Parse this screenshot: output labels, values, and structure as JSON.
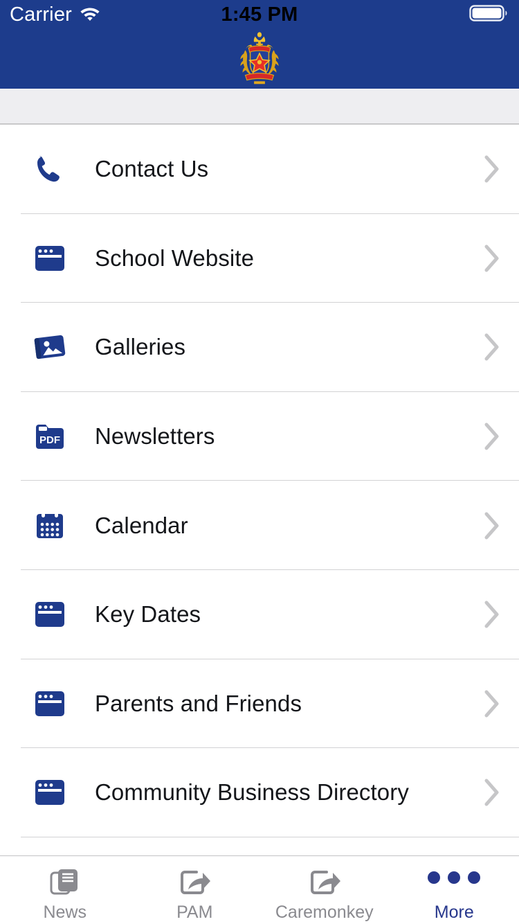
{
  "status_bar": {
    "carrier": "Carrier",
    "time": "1:45 PM",
    "wifi_icon": "wifi-icon",
    "battery_icon": "battery-full-icon"
  },
  "header": {
    "logo_icon": "school-crest-logo",
    "background_color": "#1d3c8c"
  },
  "theme": {
    "accent": "#27378c",
    "icon_blue": "#1f3b8c",
    "text": "#14161a",
    "muted": "#8a8a8f",
    "separator": "#d2d2d4",
    "subbar": "#eeeef1"
  },
  "list": {
    "items": [
      {
        "label": "Contact Us",
        "icon": "phone-icon",
        "chevron": "chevron-right-icon"
      },
      {
        "label": "School Website",
        "icon": "browser-window-icon",
        "chevron": "chevron-right-icon"
      },
      {
        "label": "Galleries",
        "icon": "photo-gallery-icon",
        "chevron": "chevron-right-icon"
      },
      {
        "label": "Newsletters",
        "icon": "pdf-folder-icon",
        "chevron": "chevron-right-icon"
      },
      {
        "label": "Calendar",
        "icon": "calendar-icon",
        "chevron": "chevron-right-icon"
      },
      {
        "label": "Key Dates",
        "icon": "browser-window-icon",
        "chevron": "chevron-right-icon"
      },
      {
        "label": "Parents and Friends",
        "icon": "browser-window-icon",
        "chevron": "chevron-right-icon"
      },
      {
        "label": "Community Business Directory",
        "icon": "browser-window-icon",
        "chevron": "chevron-right-icon"
      }
    ]
  },
  "tab_bar": {
    "tabs": [
      {
        "label": "News",
        "icon": "news-documents-icon",
        "active": false
      },
      {
        "label": "PAM",
        "icon": "external-link-icon",
        "active": false
      },
      {
        "label": "Caremonkey",
        "icon": "external-link-icon",
        "active": false
      },
      {
        "label": "More",
        "icon": "more-dots-icon",
        "active": true
      }
    ]
  },
  "icon_labels": {
    "pdf_text": "PDF"
  }
}
